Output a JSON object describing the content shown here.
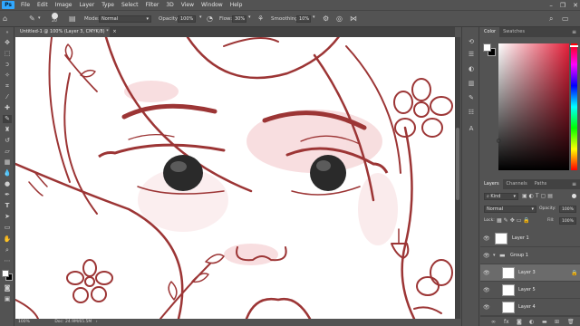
{
  "menubar": {
    "logo": "Ps",
    "items": [
      "File",
      "Edit",
      "Image",
      "Layer",
      "Type",
      "Select",
      "Filter",
      "3D",
      "View",
      "Window",
      "Help"
    ]
  },
  "window_controls": {
    "minimize": "–",
    "maximize": "❐",
    "close": "✕"
  },
  "options_bar": {
    "brush_size": "20",
    "mode_label": "Mode:",
    "mode_value": "Normal",
    "opacity_label": "Opacity:",
    "opacity_value": "100%",
    "flow_label": "Flow:",
    "flow_value": "30%",
    "smoothing_label": "Smoothing:",
    "smoothing_value": "10%"
  },
  "document": {
    "tab_title": "Untitled-1 @ 100% (Layer 3, CMYK/8) *",
    "close_glyph": "×"
  },
  "status_bar": {
    "zoom": "100%",
    "doc_info": "Doc: 24.9M/65.5M"
  },
  "color_panel": {
    "tabs": [
      "Color",
      "Swatches"
    ],
    "foreground_color": "#ffffff",
    "background_color": "#000000",
    "hue_color": "#e5203a"
  },
  "layers_panel": {
    "tabs": [
      "Layers",
      "Channels",
      "Paths"
    ],
    "kind_label": "Kind",
    "blend_mode": "Normal",
    "opacity_label": "Opacity:",
    "opacity_value": "100%",
    "lock_label": "Lock:",
    "fill_label": "Fill:",
    "fill_value": "100%",
    "layers": [
      {
        "name": "Layer 1"
      },
      {
        "name": "Group 1"
      },
      {
        "name": "Layer 3"
      },
      {
        "name": "Layer 5"
      },
      {
        "name": "Layer 4"
      }
    ]
  },
  "artwork": {
    "line_color": "#9c3535",
    "blush_color": "#f2c2c4",
    "paper_color": "#ffffff"
  }
}
